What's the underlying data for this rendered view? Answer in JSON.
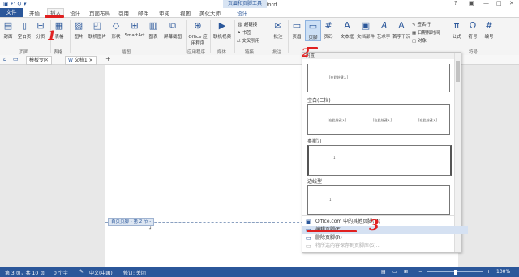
{
  "window": {
    "title": "文档1 - Word",
    "context_tab_group": "页眉和页脚工具",
    "quick_access": "▣ ↶ ↻ ▾"
  },
  "tabs": {
    "file": "文件",
    "home": "开始",
    "insert": "插入",
    "design": "设计",
    "page_layout": "页面布局",
    "references": "引用",
    "mailings": "邮件",
    "review": "审阅",
    "view": "视图",
    "beautify": "美化大师",
    "hf_design": "设计"
  },
  "ribbon": {
    "cover": "封面",
    "blank_page": "空白页",
    "page_break": "分页",
    "table": "表格",
    "picture": "图片",
    "online_picture": "联机图片",
    "shapes": "形状",
    "smartart": "SmartArt",
    "chart": "图表",
    "screenshot": "屏幕截图",
    "office_apps": "Office\n应用程序",
    "online_video": "联机视频",
    "hyperlink": "超链接",
    "bookmark": "书签",
    "cross_ref": "交叉引用",
    "comment": "批注",
    "header": "页眉",
    "footer": "页脚",
    "page_number": "页码",
    "textbox": "文本框",
    "quick_parts": "文档部件",
    "wordart": "艺术字",
    "dropcap": "首字下沉",
    "signature": "签名行",
    "datetime": "日期和时间",
    "object": "对象",
    "equation": "公式",
    "symbol": "符号",
    "number": "编号",
    "groups": {
      "pages": "页面",
      "tables": "表格",
      "illustrations": "插图",
      "apps": "应用程序",
      "media": "媒体",
      "links": "链接",
      "comments": "批注",
      "symbols": "符号"
    }
  },
  "doc_tabs": {
    "beautify_tab": "模板专区",
    "doc_tab": "文档1",
    "add": "+"
  },
  "document": {
    "footer_tag": "首页页脚 - 第 2 节 -"
  },
  "footer_dropdown": {
    "header_label": "内置",
    "samples": [
      {
        "label": "",
        "placeholder": "[在此处键入]"
      },
      {
        "label": "空白(三栏)",
        "placeholder": "[在此处键入]"
      },
      {
        "label": "奥斯汀",
        "placeholder": "1"
      },
      {
        "label": "边线型",
        "placeholder": "1"
      }
    ],
    "menu": [
      {
        "label": "Office.com 中的其他页脚(M)",
        "state": "normal"
      },
      {
        "label": "编辑页脚(E)",
        "state": "highlighted"
      },
      {
        "label": "删除页脚(R)",
        "state": "normal"
      },
      {
        "label": "将所选内容保存到页脚库(S)...",
        "state": "disabled"
      }
    ]
  },
  "annotations": [
    "1",
    "2",
    "3"
  ],
  "status": {
    "page": "第 3 页，共 10 页",
    "words": "0 个字",
    "language": "中文(中国)",
    "macro": "修订: 关闭",
    "zoom": "100%"
  },
  "colors": {
    "accent": "#2b579a",
    "annotation_red": "#e02020",
    "highlight": "#d5e1f2"
  }
}
